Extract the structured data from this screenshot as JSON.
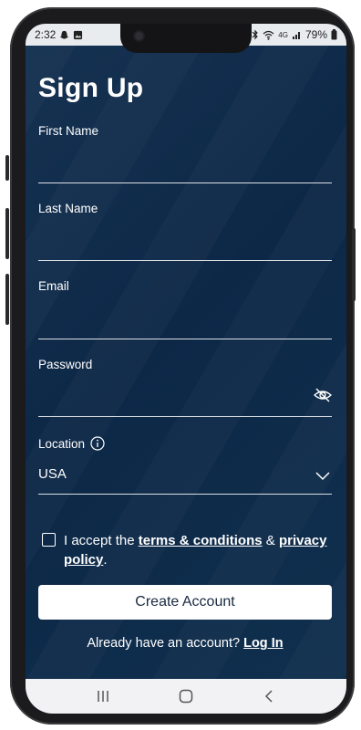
{
  "status_bar": {
    "time": "2:32",
    "battery": "79%",
    "network": "4G"
  },
  "page": {
    "title": "Sign Up"
  },
  "form": {
    "first_name_label": "First Name",
    "last_name_label": "Last Name",
    "email_label": "Email",
    "password_label": "Password",
    "location_label": "Location",
    "location_value": "USA",
    "terms_prefix": "I accept the",
    "terms_link": "terms & conditions",
    "terms_and": "&",
    "privacy_link": "privacy policy",
    "terms_suffix": ".",
    "create_button": "Create Account",
    "login_prompt": "Already have an account?",
    "login_link": "Log In"
  },
  "colors": {
    "background": "#0d2847",
    "button": "#ffffff",
    "text": "#ffffff"
  },
  "icons": [
    "snapchat-icon",
    "image-icon",
    "bluetooth-icon",
    "wifi-icon",
    "signal-icon",
    "battery-icon",
    "eye-off-icon",
    "info-icon",
    "chevron-down-icon",
    "recents-icon",
    "home-icon",
    "back-icon"
  ]
}
